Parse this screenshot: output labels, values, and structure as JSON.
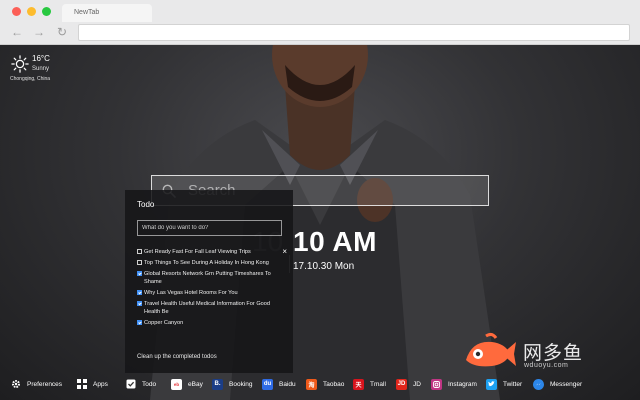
{
  "browser": {
    "tab_title": "NewTab"
  },
  "weather": {
    "temperature": "16°C",
    "condition": "Sunny",
    "location": "Chongqing,  China",
    "icon": "sun-icon"
  },
  "search": {
    "placeholder": "Search"
  },
  "clock": {
    "time": "10 AM",
    "ghost_time": "10",
    "date": "17.10.30 Mon"
  },
  "todo": {
    "title": "Todo",
    "input_placeholder": "What do you want to do?",
    "items": [
      {
        "text": "Get Ready Fast For Fall Leaf Viewing Trips",
        "done": false
      },
      {
        "text": "Top Things To See During A Holiday In Hong Kong",
        "done": false
      },
      {
        "text": "Global Resorts Network Grn Putting Timeshares To Shame",
        "done": true
      },
      {
        "text": "Why Las Vegas Hotel Rooms For You",
        "done": true
      },
      {
        "text": "Travel Health Useful Medical Information For Good Health Be",
        "done": true
      },
      {
        "text": "Copper Canyon",
        "done": true
      }
    ],
    "close_icon": "×",
    "clean_label": "Clean up the completed todos"
  },
  "bottom_bar": {
    "items": [
      {
        "label": "Preferences",
        "icon": "gear-icon",
        "color": "#ffffff"
      },
      {
        "label": "Apps",
        "icon": "grid-icon",
        "color": "#ffffff"
      },
      {
        "label": "Todo",
        "icon": "checkbox-icon",
        "color": "#ffffff"
      },
      {
        "label": "eBay",
        "icon": "ebay-icon",
        "color": "#ffffff"
      },
      {
        "label": "Booking",
        "icon": "booking-icon",
        "color": "#1b3d87"
      },
      {
        "label": "Baidu",
        "icon": "baidu-icon",
        "color": "#2e6be6"
      },
      {
        "label": "Taobao",
        "icon": "taobao-icon",
        "color": "#f05a1a"
      },
      {
        "label": "Tmall",
        "icon": "tmall-icon",
        "color": "#d8141d"
      },
      {
        "label": "JD",
        "icon": "jd-icon",
        "color": "#e1251b"
      },
      {
        "label": "Instagram",
        "icon": "instagram-icon",
        "color": "#c13584"
      },
      {
        "label": "Twitter",
        "icon": "twitter-icon",
        "color": "#1da1f2"
      },
      {
        "label": "Messenger",
        "icon": "messenger-icon",
        "color": "#2c86e8"
      }
    ]
  },
  "watermark": {
    "name": "网多鱼",
    "url": "wduoyu.com",
    "color": "#ff6a3d"
  }
}
